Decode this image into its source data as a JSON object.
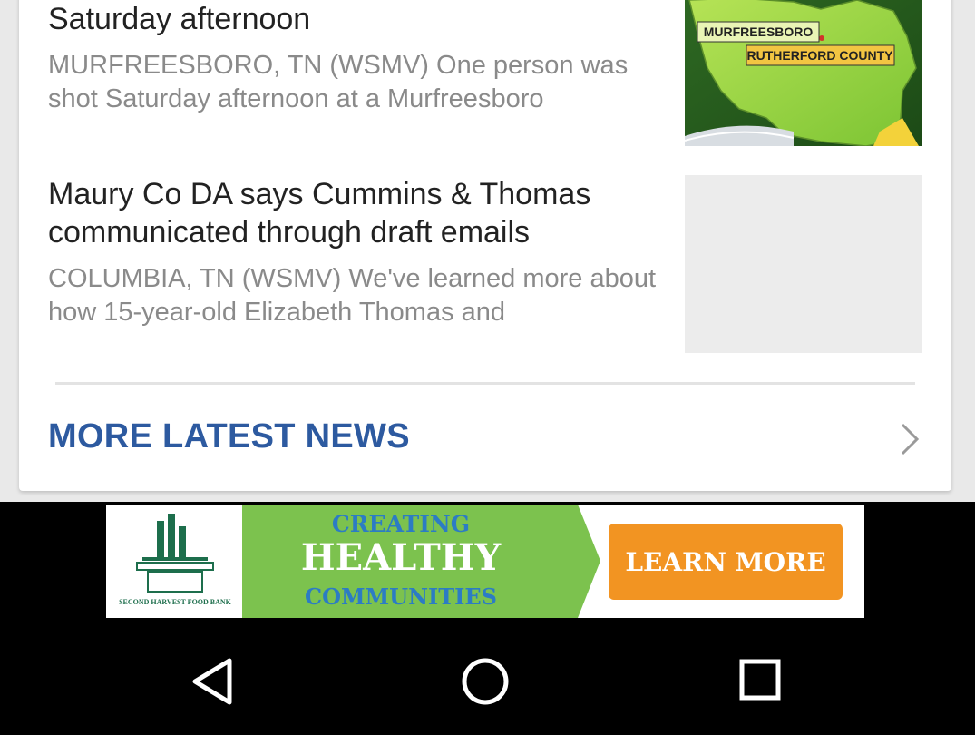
{
  "stories": [
    {
      "headline": "One shot at Murfreesboro apartment Saturday afternoon",
      "snippet": "MURFREESBORO, TN (WSMV) One person was shot Saturday afternoon at a Murfreesboro",
      "thumbnail": {
        "labels": [
          "MURFREESBORO",
          "RUTHERFORD COUNTY"
        ]
      }
    },
    {
      "headline": "Maury Co DA says Cummins & Thomas communicated through draft emails",
      "snippet": "COLUMBIA, TN (WSMV) We've learned more about how 15-year-old Elizabeth Thomas and"
    }
  ],
  "more_news": {
    "label": "MORE LATEST NEWS"
  },
  "ad": {
    "line1": "CREATING",
    "line2": "HEALTHY",
    "line3": "COMMUNITIES",
    "cta": "LEARN MORE",
    "logo_text": "SECOND HARVEST FOOD BANK"
  },
  "nav": {
    "back": "back-icon",
    "home": "home-icon",
    "recents": "recents-icon"
  },
  "colors": {
    "link_blue": "#2d5aa0",
    "ad_green": "#7cc24e",
    "ad_cta_orange": "#f29422"
  }
}
